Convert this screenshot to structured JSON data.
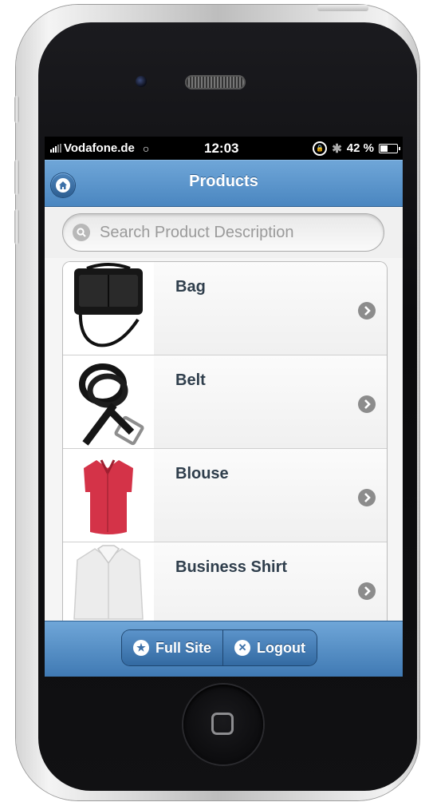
{
  "status_bar": {
    "carrier": "Vodafone.de",
    "time": "12:03",
    "battery": "42 %",
    "battery_level": 0.42
  },
  "header": {
    "title": "Products",
    "home_icon": "home-icon"
  },
  "search": {
    "placeholder": "Search Product Description",
    "value": "",
    "icon": "search-icon"
  },
  "products": [
    {
      "name": "Bag",
      "icon": "chevron-right-icon"
    },
    {
      "name": "Belt",
      "icon": "chevron-right-icon"
    },
    {
      "name": "Blouse",
      "icon": "chevron-right-icon"
    },
    {
      "name": "Business Shirt",
      "icon": "chevron-right-icon"
    }
  ],
  "footer": {
    "full_site_label": "Full Site",
    "full_site_icon": "star-icon",
    "logout_label": "Logout",
    "logout_icon": "close-icon"
  },
  "colors": {
    "header_blue": "#5a93ca",
    "label_text": "#2f3e4c",
    "blouse_red": "#d43348"
  }
}
